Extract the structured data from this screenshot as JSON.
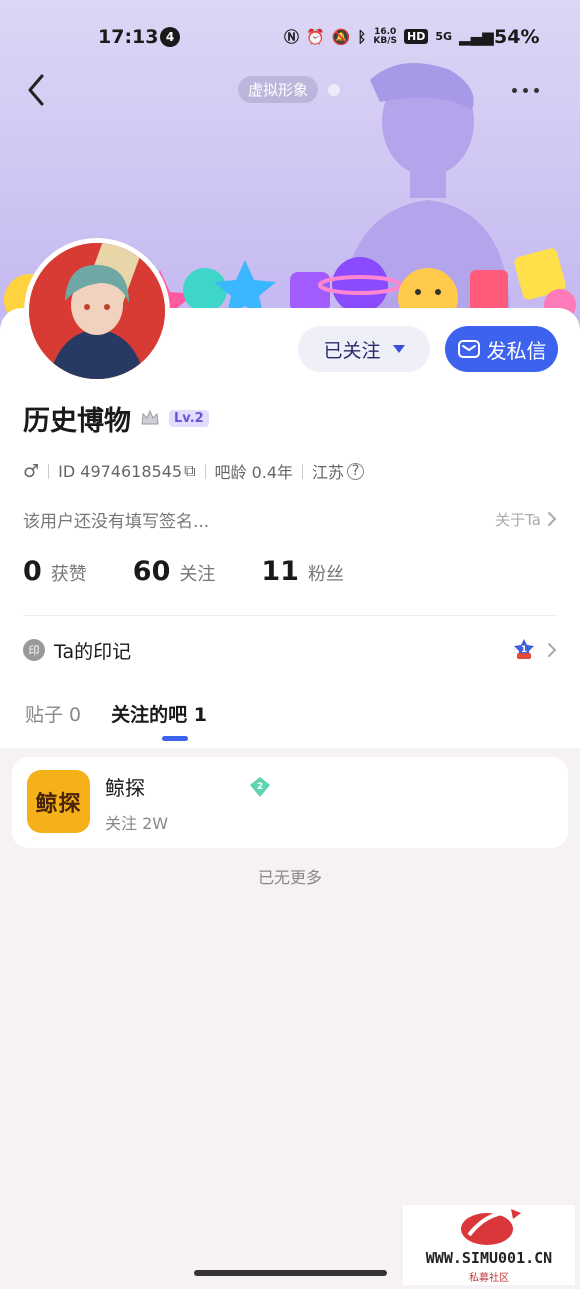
{
  "status_bar": {
    "time": "17:13",
    "notification_count": "4",
    "net_speed_value": "16.0",
    "net_speed_unit": "KB/S",
    "hd": "HD",
    "signal": "5G",
    "battery": "54%"
  },
  "header": {
    "virtual_label": "虚拟形象"
  },
  "actions": {
    "follow_label": "已关注",
    "message_label": "发私信"
  },
  "profile": {
    "name": "历史博物",
    "level": "Lv.2",
    "id_text": "ID 4974618545",
    "bar_age": "吧龄 0.4年",
    "location": "江苏",
    "signature": "该用户还没有填写签名...",
    "about_label": "关于Ta"
  },
  "stats": {
    "likes_count": "0",
    "likes_label": "获赞",
    "following_count": "60",
    "following_label": "关注",
    "fans_count": "11",
    "fans_label": "粉丝"
  },
  "seal": {
    "icon_text": "印",
    "label": "Ta的印记",
    "badge_number": "1"
  },
  "tabs": [
    {
      "label": "贴子 0"
    },
    {
      "label": "关注的吧 1"
    }
  ],
  "forums": [
    {
      "logo_text": "鲸探",
      "name": "鲸探",
      "level": "2",
      "followers": "关注 2W"
    }
  ],
  "list_end": "已无更多",
  "watermark": {
    "site": "WWW.SIMU001.CN",
    "subtitle": "私募社区"
  },
  "colors": {
    "accent": "#3d63ee",
    "header_bg": "#cfc6f3",
    "level_badge": "#6a55d8",
    "forum_logo": "#f5b11a"
  }
}
